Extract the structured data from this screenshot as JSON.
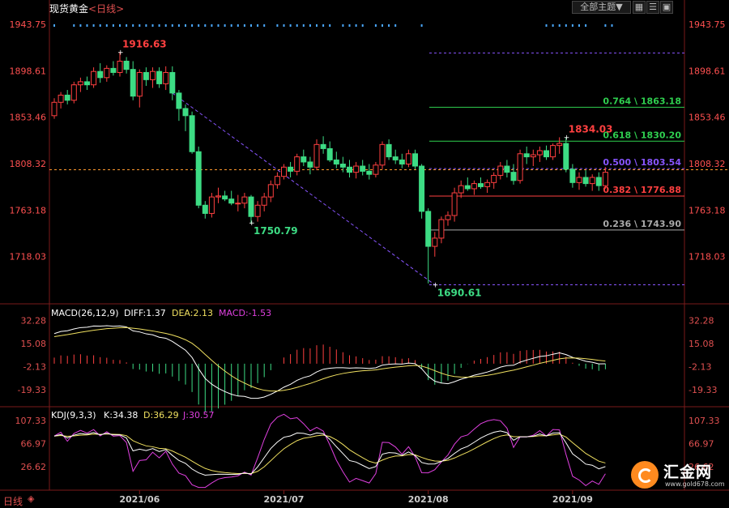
{
  "header": {
    "instrument": "现货黄金",
    "period": "<日线>",
    "theme_select": "全部主题▼",
    "tool_buttons": [
      "grid",
      "menu",
      "fullscreen"
    ],
    "bottom_period": "日线",
    "bottom_icons": [
      "settings-icon",
      "list-icon"
    ]
  },
  "watermark": {
    "name": "汇金网",
    "url": "www.gold678.com"
  },
  "colors": {
    "up": "#ff4040",
    "down": "#3ddc84",
    "price_axis": "#ff5050",
    "indicator_axis": "#e05050",
    "dash_line": "#ff9a2e",
    "trend": "#8855ff",
    "fib_purple": "#8855ff",
    "fib_green": "#2fcf4f",
    "fib_red": "#ff4040",
    "fib_gray": "#aaaaaa",
    "macd_diff": "#ffffff",
    "macd_dea": "#f0e060",
    "macd_hist_label": "#e040e0",
    "kdj_j": "#e040e0"
  },
  "chart_data": {
    "type": "candlestick",
    "title": "现货黄金<日线>",
    "y_ticks": [
      "1943.75",
      "1898.61",
      "1853.46",
      "1808.32",
      "1763.18",
      "1718.03"
    ],
    "ylim": [
      1674.5,
      1958.0
    ],
    "x_ticks": [
      {
        "label": "2021/06",
        "idx": 13
      },
      {
        "label": "2021/07",
        "idx": 35
      },
      {
        "label": "2021/08",
        "idx": 57
      },
      {
        "label": "2021/09",
        "idx": 79
      }
    ],
    "annotations": [
      {
        "text": "1916.63",
        "idx": 10,
        "value": 1916.63,
        "color": "#ff4040"
      },
      {
        "text": "1750.79",
        "idx": 30,
        "value": 1750.79,
        "color": "#3ddc84"
      },
      {
        "text": "1690.61",
        "idx": 58,
        "value": 1690.61,
        "color": "#3ddc84"
      },
      {
        "text": "1834.03",
        "idx": 78,
        "value": 1834.03,
        "color": "#ff4040"
      }
    ],
    "fib_levels": [
      {
        "label": "0.764 \\ 1863.18",
        "value": 1863.18,
        "color": "#2fcf4f",
        "style": "solid"
      },
      {
        "label": "0.618 \\ 1830.20",
        "value": 1830.2,
        "color": "#2fcf4f",
        "style": "solid"
      },
      {
        "label": "0.500 \\ 1803.54",
        "value": 1803.54,
        "color": "#8855ff",
        "style": "dashed"
      },
      {
        "label": "0.382 \\ 1776.88",
        "value": 1776.88,
        "color": "#ff4040",
        "style": "solid"
      },
      {
        "label": "0.236 \\ 1743.90",
        "value": 1743.9,
        "color": "#aaaaaa",
        "style": "solid"
      },
      {
        "label": "",
        "value": 1916.0,
        "color": "#8855ff",
        "style": "dashed"
      },
      {
        "label": "",
        "value": 1690.61,
        "color": "#8855ff",
        "style": "dashed"
      }
    ],
    "current_price": 1802.5,
    "trendline": [
      {
        "idx": 18,
        "value": 1877
      },
      {
        "idx": 58,
        "value": 1690.61
      }
    ],
    "candles": [
      [
        1855,
        1872,
        1852,
        1868
      ],
      [
        1868,
        1878,
        1862,
        1875
      ],
      [
        1875,
        1880,
        1866,
        1870
      ],
      [
        1870,
        1888,
        1867,
        1885
      ],
      [
        1885,
        1892,
        1878,
        1888
      ],
      [
        1888,
        1893,
        1880,
        1885
      ],
      [
        1885,
        1902,
        1882,
        1898
      ],
      [
        1898,
        1906,
        1887,
        1892
      ],
      [
        1892,
        1904,
        1888,
        1901
      ],
      [
        1901,
        1908,
        1894,
        1897
      ],
      [
        1897,
        1917,
        1893,
        1908
      ],
      [
        1908,
        1912,
        1896,
        1900
      ],
      [
        1900,
        1908,
        1870,
        1874
      ],
      [
        1874,
        1900,
        1863,
        1897
      ],
      [
        1897,
        1902,
        1884,
        1890
      ],
      [
        1890,
        1902,
        1882,
        1898
      ],
      [
        1898,
        1902,
        1882,
        1886
      ],
      [
        1886,
        1903,
        1880,
        1897
      ],
      [
        1897,
        1903,
        1870,
        1877
      ],
      [
        1877,
        1880,
        1850,
        1862
      ],
      [
        1862,
        1866,
        1840,
        1855
      ],
      [
        1855,
        1859,
        1818,
        1820
      ],
      [
        1820,
        1825,
        1765,
        1768
      ],
      [
        1768,
        1772,
        1755,
        1760
      ],
      [
        1760,
        1780,
        1756,
        1776
      ],
      [
        1776,
        1785,
        1770,
        1777
      ],
      [
        1777,
        1782,
        1772,
        1774
      ],
      [
        1774,
        1782,
        1768,
        1770
      ],
      [
        1770,
        1778,
        1762,
        1770
      ],
      [
        1770,
        1780,
        1765,
        1776
      ],
      [
        1776,
        1778,
        1750,
        1757
      ],
      [
        1757,
        1772,
        1752,
        1768
      ],
      [
        1768,
        1780,
        1762,
        1776
      ],
      [
        1776,
        1792,
        1771,
        1788
      ],
      [
        1788,
        1800,
        1784,
        1796
      ],
      [
        1796,
        1808,
        1793,
        1805
      ],
      [
        1805,
        1810,
        1795,
        1801
      ],
      [
        1801,
        1818,
        1797,
        1815
      ],
      [
        1815,
        1822,
        1806,
        1810
      ],
      [
        1810,
        1815,
        1798,
        1805
      ],
      [
        1805,
        1832,
        1802,
        1827
      ],
      [
        1827,
        1835,
        1818,
        1823
      ],
      [
        1823,
        1830,
        1810,
        1812
      ],
      [
        1812,
        1820,
        1804,
        1808
      ],
      [
        1808,
        1815,
        1800,
        1805
      ],
      [
        1805,
        1812,
        1795,
        1800
      ],
      [
        1800,
        1810,
        1794,
        1806
      ],
      [
        1806,
        1812,
        1797,
        1801
      ],
      [
        1801,
        1808,
        1793,
        1798
      ],
      [
        1798,
        1810,
        1795,
        1807
      ],
      [
        1807,
        1830,
        1803,
        1827
      ],
      [
        1827,
        1832,
        1812,
        1815
      ],
      [
        1815,
        1822,
        1808,
        1812
      ],
      [
        1812,
        1818,
        1804,
        1808
      ],
      [
        1808,
        1822,
        1805,
        1818
      ],
      [
        1818,
        1822,
        1803,
        1806
      ],
      [
        1806,
        1808,
        1755,
        1762
      ],
      [
        1762,
        1765,
        1692,
        1728
      ],
      [
        1728,
        1742,
        1718,
        1736
      ],
      [
        1736,
        1757,
        1731,
        1754
      ],
      [
        1754,
        1762,
        1748,
        1758
      ],
      [
        1758,
        1785,
        1752,
        1780
      ],
      [
        1780,
        1792,
        1775,
        1787
      ],
      [
        1787,
        1795,
        1782,
        1784
      ],
      [
        1784,
        1792,
        1778,
        1789
      ],
      [
        1789,
        1795,
        1784,
        1786
      ],
      [
        1786,
        1793,
        1780,
        1790
      ],
      [
        1790,
        1800,
        1784,
        1797
      ],
      [
        1797,
        1810,
        1793,
        1806
      ],
      [
        1806,
        1812,
        1795,
        1800
      ],
      [
        1800,
        1808,
        1788,
        1792
      ],
      [
        1792,
        1822,
        1789,
        1818
      ],
      [
        1818,
        1825,
        1808,
        1815
      ],
      [
        1815,
        1822,
        1806,
        1817
      ],
      [
        1817,
        1825,
        1810,
        1821
      ],
      [
        1821,
        1826,
        1812,
        1815
      ],
      [
        1815,
        1828,
        1812,
        1826
      ],
      [
        1826,
        1834,
        1818,
        1828
      ],
      [
        1828,
        1834,
        1800,
        1803
      ],
      [
        1803,
        1808,
        1785,
        1790
      ],
      [
        1790,
        1800,
        1783,
        1795
      ],
      [
        1795,
        1802,
        1786,
        1789
      ],
      [
        1789,
        1798,
        1782,
        1795
      ],
      [
        1795,
        1800,
        1782,
        1787
      ],
      [
        1787,
        1805,
        1784,
        1800
      ]
    ],
    "macd": {
      "label": "MACD(26,12,9)",
      "diff_label": "DIFF:1.37",
      "dea_label": "DEA:2.13",
      "hist_label": "MACD:-1.53",
      "y_ticks": [
        "32.28",
        "15.08",
        "-2.13",
        "-19.33"
      ],
      "ylim": [
        -31,
        43
      ]
    },
    "kdj": {
      "label": "KDJ(9,3,3)",
      "k_label": "K:34.38",
      "d_label": "D:36.29",
      "j_label": "J:30.57",
      "y_ticks": [
        "107.33",
        "66.97",
        "26.62"
      ],
      "ylim": [
        -12,
        130
      ]
    }
  }
}
